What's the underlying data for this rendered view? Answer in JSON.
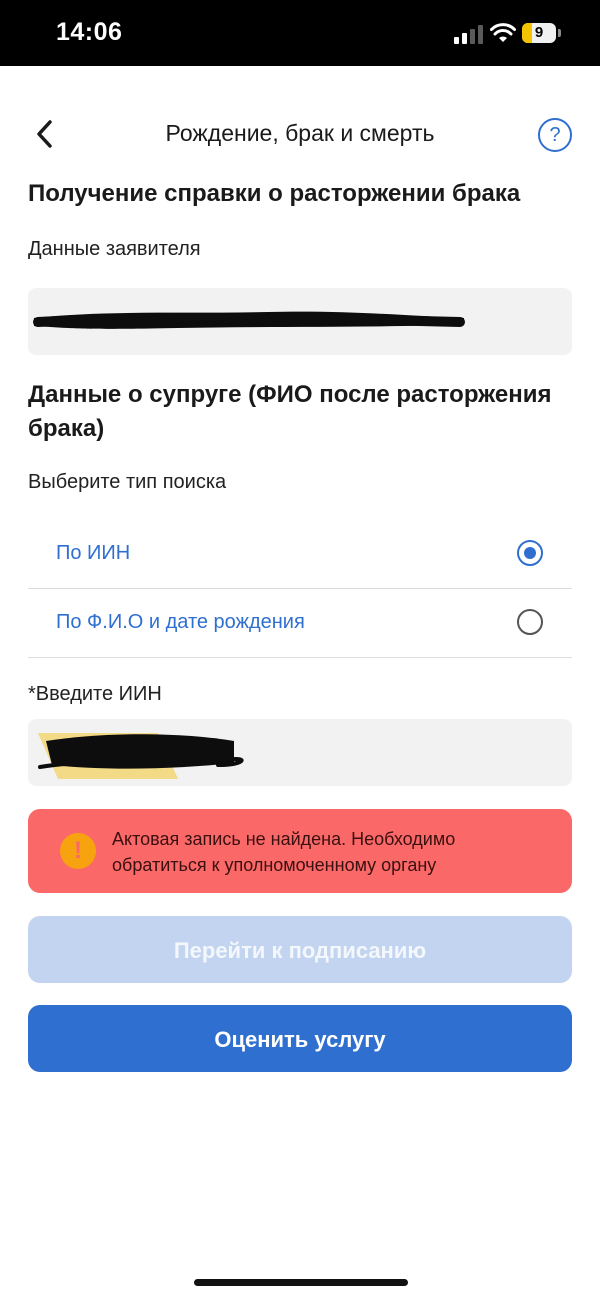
{
  "status_bar": {
    "time": "14:06",
    "battery": "9",
    "icons": [
      "cellular-signal-icon",
      "wifi-icon",
      "battery-icon"
    ]
  },
  "nav": {
    "back_icon": "chevron-left-icon",
    "title": "Рождение, брак и смерть",
    "help_icon": "help-question-icon",
    "help_label": "?"
  },
  "page_title": "Получение справки о расторжении брака",
  "applicant": {
    "label": "Данные заявителя",
    "value": ""
  },
  "spouse_section": {
    "title": "Данные о супруге (ФИО после расторжения брака)"
  },
  "search_type": {
    "label": "Выберите тип поиска",
    "options": [
      {
        "label": "По ИИН",
        "selected": true
      },
      {
        "label": "По Ф.И.О и дате рождения",
        "selected": false
      }
    ]
  },
  "iin": {
    "label": "*Введите ИИН",
    "value": ""
  },
  "alert": {
    "icon": "exclamation-icon",
    "icon_label": "!",
    "text": "Актовая запись не найдена. Необходимо обратиться к уполномоченному органу"
  },
  "buttons": {
    "sign": "Перейти к подписанию",
    "rate": "Оценить услугу"
  },
  "colors": {
    "accent": "#2f6fcf",
    "alert_bg": "#fb6868",
    "alert_icon": "#f7a30f",
    "disabled_button": "#c2d4f0"
  }
}
